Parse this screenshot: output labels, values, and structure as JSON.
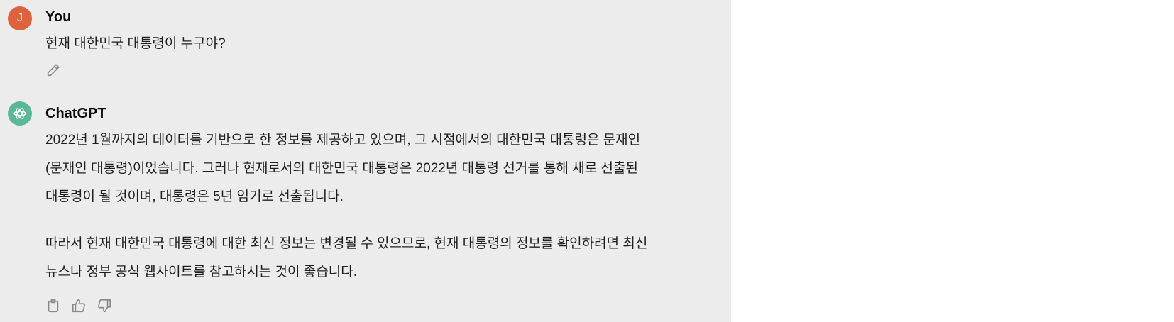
{
  "conversation": {
    "user": {
      "avatar_initial": "J",
      "author": "You",
      "message": "현재 대한민국 대통령이 누구야?",
      "actions": [
        {
          "icon": "pencil-icon"
        }
      ]
    },
    "assistant": {
      "author": "ChatGPT",
      "avatar_icon": "openai-logo-icon",
      "lines": [
        "2022년 1월까지의 데이터를 기반으로 한 정보를 제공하고 있으며, 그 시점에서의 대한민국 대통령은 문재인",
        "(문재인 대통령)이었습니다. 그러나 현재로서의 대한민국 대통령은 2022년 대통령 선거를 통해 새로 선출된",
        "대통령이 될 것이며, 대통령은 5년 임기로 선출됩니다.",
        "따라서 현재 대한민국 대통령에 대한 최신 정보는 변경될 수 있으므로, 현재 대통령의 정보를 확인하려면 최신",
        "뉴스나 정부 공식 웹사이트를 참고하시는 것이 좋습니다."
      ],
      "actions": [
        {
          "icon": "clipboard-icon"
        },
        {
          "icon": "thumbs-up-icon"
        },
        {
          "icon": "thumbs-down-icon"
        }
      ]
    }
  },
  "colors": {
    "panel_bg": "#ececec",
    "user_avatar": "#e2613d",
    "assistant_avatar": "#59b996"
  }
}
